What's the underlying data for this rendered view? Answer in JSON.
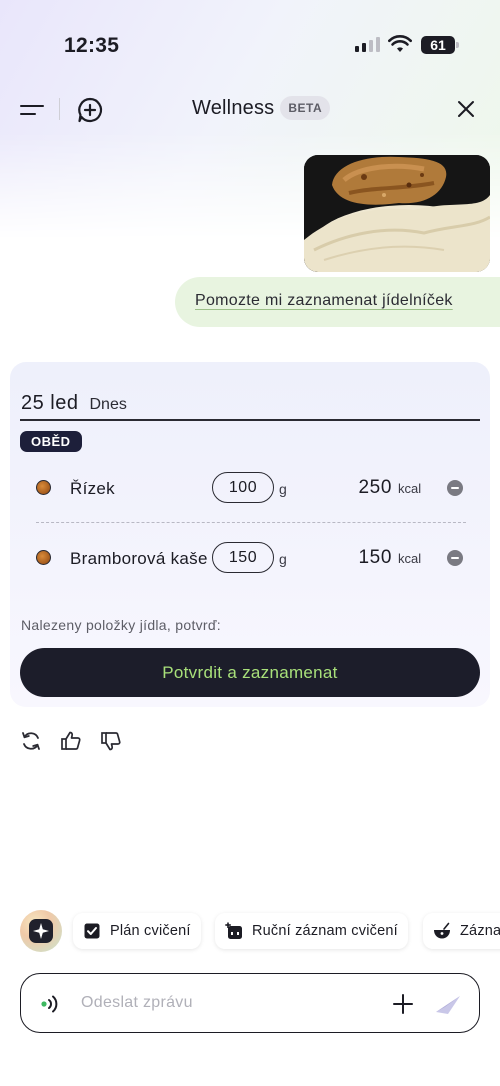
{
  "status_bar": {
    "time": "12:35",
    "battery": "61",
    "battery_level": 0.61
  },
  "header": {
    "title": "Wellness",
    "badge": "BETA"
  },
  "chat": {
    "user_message": "Pomozte mi zaznamenat jídelníček"
  },
  "meal_card": {
    "date": "25 led",
    "day_label": "Dnes",
    "meal_type": "OBĚD",
    "items": [
      {
        "name": "Řízek",
        "quantity": "100",
        "unit": "g",
        "kcal": "250",
        "kcal_unit": "kcal"
      },
      {
        "name": "Bramborová kaše",
        "quantity": "150",
        "unit": "g",
        "kcal": "150",
        "kcal_unit": "kcal"
      }
    ],
    "found_text": "Nalezeny položky jídla, potvrď:",
    "confirm_label": "Potvrdit a zaznamenat"
  },
  "quick_actions": [
    {
      "label": "Plán cvičení",
      "icon": "checkbox-icon"
    },
    {
      "label": "Ruční záznam cvičení",
      "icon": "plus-calendar-icon"
    },
    {
      "label": "Zázna",
      "icon": "food-bowl-icon"
    }
  ],
  "composer": {
    "placeholder": "Odeslat zprávu"
  },
  "colors": {
    "accent_green": "#a8e07a",
    "dark": "#1c1d2a",
    "bubble": "#e8f4e0"
  }
}
